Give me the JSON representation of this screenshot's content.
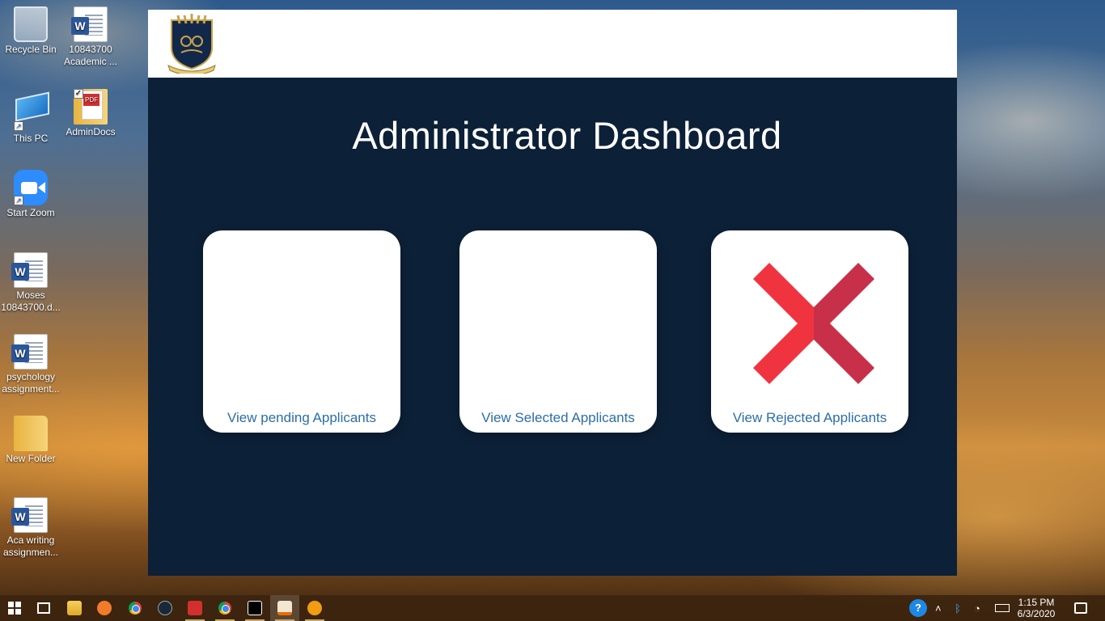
{
  "desktop": {
    "icons": [
      {
        "label": "Recycle Bin",
        "icon": "recycle-bin-icon"
      },
      {
        "label": "10843700 Academic ...",
        "icon": "word-document-icon"
      },
      {
        "label": "This PC",
        "icon": "this-pc-icon"
      },
      {
        "label": "AdminDocs",
        "icon": "pdf-folder-icon"
      },
      {
        "label": "Start Zoom",
        "icon": "zoom-icon"
      },
      {
        "label": "Moses 10843700.d...",
        "icon": "word-document-icon"
      },
      {
        "label": "psychology assignment...",
        "icon": "word-document-icon"
      },
      {
        "label": "New Folder",
        "icon": "folder-icon"
      },
      {
        "label": "Aca writing assignmen...",
        "icon": "word-document-icon"
      }
    ]
  },
  "app": {
    "title": "Administrator Dashboard",
    "logo": "university-crest-logo",
    "colors": {
      "header_bg": "#ffffff",
      "body_bg": "#0c2037",
      "link": "#2c6ea4"
    },
    "cards": [
      {
        "label": "View pending Applicants",
        "icon": ""
      },
      {
        "label": "View Selected Applicants",
        "icon": ""
      },
      {
        "label": "View Rejected Applicants",
        "icon": "red-x-icon"
      }
    ]
  },
  "taskbar": {
    "apps": [
      "start-icon",
      "task-view-icon",
      "file-explorer-icon",
      "paint-icon",
      "chrome-icon",
      "steam-icon",
      "acrobat-icon",
      "chrome-icon",
      "intellij-icon",
      "java-icon",
      "app-icon"
    ],
    "clock": {
      "time": "1:15 PM",
      "date": "6/3/2020"
    }
  }
}
